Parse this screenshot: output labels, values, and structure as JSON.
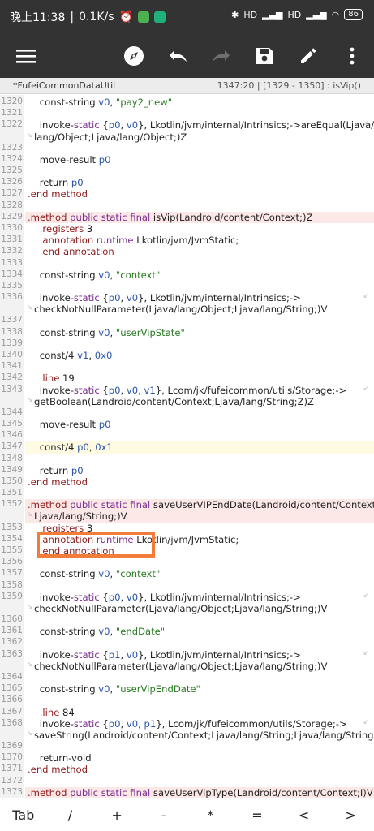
{
  "status_bar": {
    "time": "晚上11:38",
    "speed": "0.1K/s",
    "net1": "HD",
    "net2": "HD",
    "battery": "86"
  },
  "toolbar": {
    "icons": [
      "menu-icon",
      "compass-icon",
      "undo-icon",
      "redo-icon",
      "save-icon",
      "edit-icon",
      "more-icon"
    ]
  },
  "file": {
    "name": "*FufeiCommonDataUtil",
    "position": "1347:20  |  [1329 - 1350] : isVip()"
  },
  "editor": {
    "lines": [
      {
        "n": "1320",
        "text": "    const-string v0, \"pay2_new\""
      },
      {
        "n": "1321",
        "text": ""
      },
      {
        "n": "1322",
        "text": "    invoke-static {p0, v0}, Lkotlin/jvm/internal/Intrinsics;->areEqual(Ljava/"
      },
      {
        "n": "",
        "text": "lang/Object;Ljava/lang/Object;)Z"
      },
      {
        "n": "1323",
        "text": ""
      },
      {
        "n": "1324",
        "text": "    move-result p0"
      },
      {
        "n": "1325",
        "text": ""
      },
      {
        "n": "1326",
        "text": "    return p0"
      },
      {
        "n": "1327",
        "text": ".end method"
      },
      {
        "n": "1328",
        "text": ""
      },
      {
        "n": "1329",
        "text": ".method public static final isVip(Landroid/content/Context;)Z"
      },
      {
        "n": "1330",
        "text": "    .registers 3"
      },
      {
        "n": "1331",
        "text": "    .annotation runtime Lkotlin/jvm/JvmStatic;"
      },
      {
        "n": "1332",
        "text": "    .end annotation"
      },
      {
        "n": "1333",
        "text": ""
      },
      {
        "n": "1334",
        "text": "    const-string v0, \"context\""
      },
      {
        "n": "1335",
        "text": ""
      },
      {
        "n": "1336",
        "text": "    invoke-static {p0, v0}, Lkotlin/jvm/internal/Intrinsics;->"
      },
      {
        "n": "",
        "text": "checkNotNullParameter(Ljava/lang/Object;Ljava/lang/String;)V"
      },
      {
        "n": "1337",
        "text": ""
      },
      {
        "n": "1338",
        "text": "    const-string v0, \"userVipState\""
      },
      {
        "n": "1339",
        "text": ""
      },
      {
        "n": "1340",
        "text": "    const/4 v1, 0x0"
      },
      {
        "n": "1341",
        "text": ""
      },
      {
        "n": "1342",
        "text": "    .line 19"
      },
      {
        "n": "1343",
        "text": "    invoke-static {p0, v0, v1}, Lcom/jk/fufeicommon/utils/Storage;->"
      },
      {
        "n": "",
        "text": "getBoolean(Landroid/content/Context;Ljava/lang/String;Z)Z"
      },
      {
        "n": "1344",
        "text": ""
      },
      {
        "n": "1345",
        "text": "    move-result p0"
      },
      {
        "n": "1346",
        "text": ""
      },
      {
        "n": "1347",
        "text": "    const/4 p0, 0x1"
      },
      {
        "n": "1348",
        "text": ""
      },
      {
        "n": "1349",
        "text": "    return p0"
      },
      {
        "n": "1350",
        "text": ".end method"
      },
      {
        "n": "1351",
        "text": ""
      },
      {
        "n": "1352",
        "text": ".method public static final saveUserVIPEndDate(Landroid/content/Context;"
      },
      {
        "n": "",
        "text": "Ljava/lang/String;)V"
      },
      {
        "n": "1353",
        "text": "    .registers 3"
      },
      {
        "n": "1354",
        "text": "    .annotation runtime Lkotlin/jvm/JvmStatic;"
      },
      {
        "n": "1355",
        "text": "    .end annotation"
      },
      {
        "n": "1356",
        "text": ""
      },
      {
        "n": "1357",
        "text": "    const-string v0, \"context\""
      },
      {
        "n": "1358",
        "text": ""
      },
      {
        "n": "1359",
        "text": "    invoke-static {p0, v0}, Lkotlin/jvm/internal/Intrinsics;->"
      },
      {
        "n": "",
        "text": "checkNotNullParameter(Ljava/lang/Object;Ljava/lang/String;)V"
      },
      {
        "n": "1360",
        "text": ""
      },
      {
        "n": "1361",
        "text": "    const-string v0, \"endDate\""
      },
      {
        "n": "1362",
        "text": ""
      },
      {
        "n": "1363",
        "text": "    invoke-static {p1, v0}, Lkotlin/jvm/internal/Intrinsics;->"
      },
      {
        "n": "",
        "text": "checkNotNullParameter(Ljava/lang/Object;Ljava/lang/String;)V"
      },
      {
        "n": "1364",
        "text": ""
      },
      {
        "n": "1365",
        "text": "    const-string v0, \"userVipEndDate\""
      },
      {
        "n": "1366",
        "text": ""
      },
      {
        "n": "1367",
        "text": "    .line 84"
      },
      {
        "n": "1368",
        "text": "    invoke-static {p0, v0, p1}, Lcom/jk/fufeicommon/utils/Storage;->"
      },
      {
        "n": "",
        "text": "saveString(Landroid/content/Context;Ljava/lang/String;Ljava/lang/String;)V"
      },
      {
        "n": "1369",
        "text": ""
      },
      {
        "n": "1370",
        "text": "    return-void"
      },
      {
        "n": "1371",
        "text": ".end method"
      },
      {
        "n": "1372",
        "text": ""
      },
      {
        "n": "1373",
        "text": ".method public static final saveUserVipType(Landroid/content/Context;I)V"
      }
    ],
    "current_line": "1347"
  },
  "keys": [
    "Tab",
    "/",
    "+",
    "-",
    "*",
    "=",
    "<",
    ">"
  ],
  "colors": {
    "bar": "#333333",
    "method_bg": "#fde8e8",
    "current_line_bg": "#fffbe3",
    "highlight_box": "#f27d3a"
  }
}
